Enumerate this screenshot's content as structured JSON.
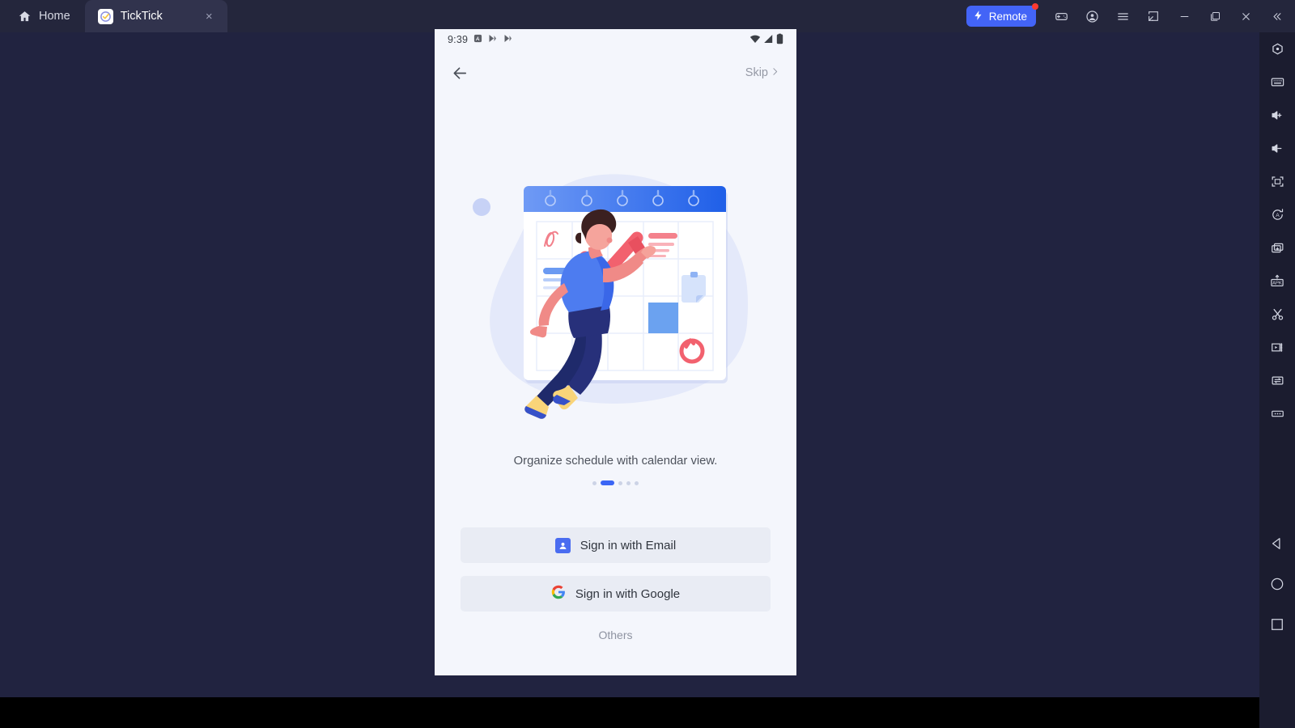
{
  "window": {
    "tabs": [
      {
        "label": "Home",
        "icon": "home-icon",
        "active": false
      },
      {
        "label": "TickTick",
        "icon": "ticktick-app-icon",
        "active": true,
        "close": "×"
      }
    ],
    "controls": {
      "remote_label": "Remote",
      "remote_icon": "lightning-bolt-icon",
      "items": [
        "gamepad-icon",
        "account-icon",
        "menu-icon",
        "screenshot-icon",
        "minimize-icon",
        "maximize-icon",
        "close-icon",
        "collapse-icon"
      ]
    },
    "accent_blue": "#4364f7",
    "notification_dot_color": "#ff3b30",
    "titlebar_color": "#24263c",
    "canvas_color": "#212340",
    "sidebar_color": "#1b1c2f"
  },
  "sidebar": {
    "tools": [
      "settings-hexagon-icon",
      "keyboard-icon",
      "volume-up-icon",
      "volume-down-icon",
      "fullscreen-icon",
      "auto-rotate-icon",
      "multi-instance-icon",
      "apk-install-icon",
      "scissors-icon",
      "screen-record-icon",
      "file-transfer-icon",
      "more-options-icon"
    ],
    "nav": [
      "android-back-icon",
      "android-home-icon",
      "android-recents-icon"
    ]
  },
  "phone": {
    "status_bar": {
      "time": "9:39",
      "left_icons": [
        "app-notification-icon",
        "play-notification-icon",
        "play-notification-icon-2"
      ],
      "right_icons": [
        "wifi-icon",
        "signal-icon",
        "battery-icon"
      ]
    },
    "top_bar": {
      "back_icon": "back-arrow-icon",
      "skip_label": "Skip",
      "skip_chevron": "chevron-right-icon"
    },
    "illustration": {
      "name": "calendar-organization-illustration",
      "description": "person reaching up to mark a red check on a wall calendar"
    },
    "caption": "Organize schedule with calendar view.",
    "page_indicator": {
      "count": 5,
      "active_index": 1,
      "active_color": "#3b66f5",
      "inactive_color": "#ccd3e6"
    },
    "buttons": [
      {
        "label": "Sign in with Email",
        "icon": "email-contact-icon"
      },
      {
        "label": "Sign in with Google",
        "icon": "google-g-icon"
      }
    ],
    "others_label": "Others",
    "screen_bg": "#f4f6fc",
    "button_bg": "#e9ecf4"
  }
}
